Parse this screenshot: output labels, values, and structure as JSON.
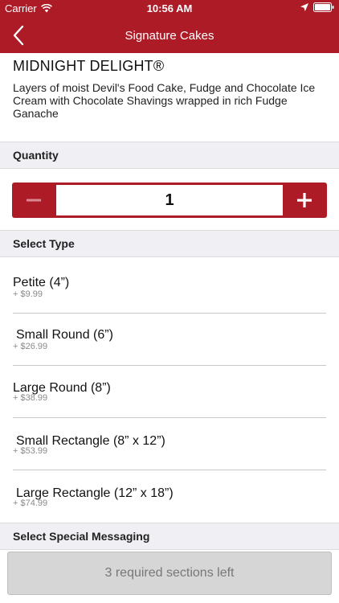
{
  "status_bar": {
    "carrier": "Carrier",
    "time": "10:56 AM"
  },
  "nav": {
    "title": "Signature Cakes"
  },
  "product": {
    "name": "MIDNIGHT DELIGHT®",
    "description": "Layers of moist Devil's Food Cake, Fudge and Chocolate Ice Cream with Chocolate Shavings wrapped in rich Fudge Ganache"
  },
  "quantity": {
    "header": "Quantity",
    "value": "1",
    "minus_symbol": "−",
    "plus_symbol": "+"
  },
  "select_type": {
    "header": "Select Type",
    "options": [
      {
        "label": "Petite (4”)",
        "price": "+ $9.99"
      },
      {
        "label": "Small Round (6”)",
        "price": "+ $26.99"
      },
      {
        "label": "Large Round (8”)",
        "price": "+ $38.99"
      },
      {
        "label": "Small Rectangle (8” x 12”)",
        "price": "+ $53.99"
      },
      {
        "label": "Large Rectangle (12” x 18”)",
        "price": "+ $74.99"
      }
    ]
  },
  "special_messaging": {
    "header": "Select Special Messaging"
  },
  "footer": {
    "status": "3 required sections left"
  },
  "colors": {
    "brand": "#ad1b27",
    "section_bg": "#efeff4",
    "disabled_button": "#d6d6d6"
  },
  "icons": {
    "wifi": "wifi-icon",
    "location": "location-arrow-icon",
    "battery": "battery-icon",
    "back": "chevron-left-icon"
  }
}
